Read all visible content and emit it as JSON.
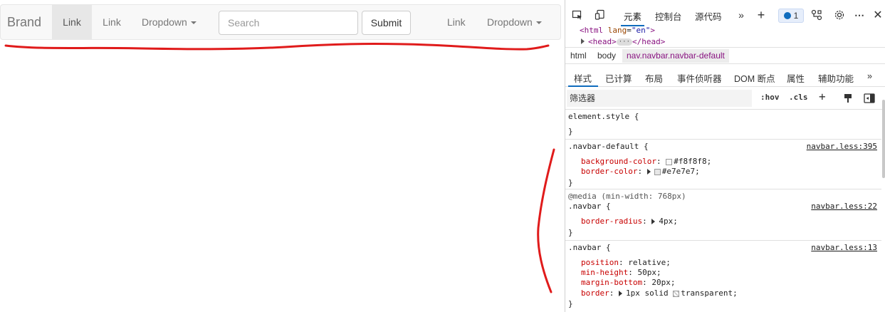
{
  "navbar": {
    "brand": "Brand",
    "link1": "Link",
    "link2": "Link",
    "dropdown1": "Dropdown",
    "search_placeholder": "Search",
    "submit": "Submit",
    "link3": "Link",
    "dropdown2": "Dropdown"
  },
  "devtools": {
    "tabs": [
      "元素",
      "控制台",
      "源代码"
    ],
    "issues_count": "1",
    "dom": {
      "html_tag": "<html",
      "html_attr": "lang",
      "html_val": "\"en\"",
      "head_open": "<head>",
      "head_close": "</head>"
    },
    "breadcrumbs": [
      "html",
      "body",
      "nav.navbar.navbar-default"
    ],
    "subtabs": [
      "样式",
      "已计算",
      "布局",
      "事件侦听器",
      "DOM 断点",
      "属性",
      "辅助功能"
    ],
    "filter_placeholder": "筛选器",
    "filter_hov": ":hov",
    "filter_cls": ".cls",
    "rules": {
      "element_style": "element.style {",
      "close": "}",
      "r1_selector": ".navbar-default {",
      "r1_source": "navbar.less:395",
      "r1_prop1": "background-color",
      "r1_val1": "#f8f8f8;",
      "r1_prop2": "border-color",
      "r1_val2": "#e7e7e7;",
      "r2_media": "@media (min-width: 768px)",
      "r2_selector": ".navbar {",
      "r2_source": "navbar.less:22",
      "r2_prop1": "border-radius",
      "r2_val1": "4px;",
      "r3_selector": ".navbar {",
      "r3_source": "navbar.less:13",
      "r3_prop1": "position",
      "r3_val1": "relative;",
      "r3_prop2": "min-height",
      "r3_val2": "50px;",
      "r3_prop3": "margin-bottom",
      "r3_val3": "20px;",
      "r3_prop4": "border",
      "r3_val4": "1px solid",
      "r3_val4b": "transparent;"
    }
  },
  "colors": {
    "annotation": "#e01b1b",
    "accent": "#0f6cbd",
    "navbar_bg": "#f8f8f8",
    "navbar_border": "#e7e7e7"
  }
}
